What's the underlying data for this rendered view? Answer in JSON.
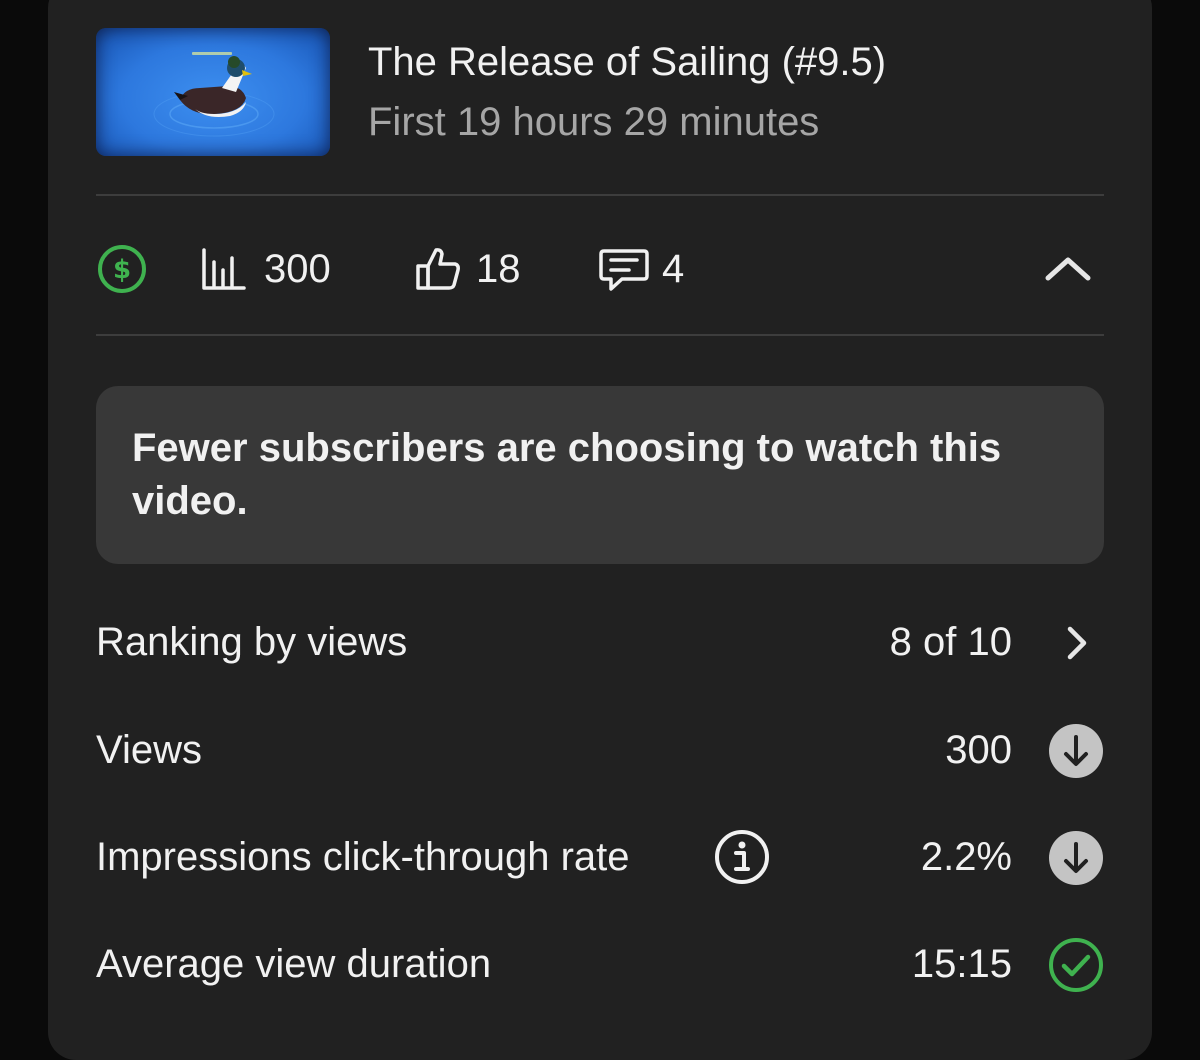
{
  "video": {
    "title": "The Release of Sailing (#9.5)",
    "period": "First 19 hours 29 minutes",
    "thumbnail_icon": "duck-thumbnail-image"
  },
  "stats": {
    "monetization_icon": "dollar-circle-icon",
    "monetization_color": "#3fb24f",
    "views": "300",
    "likes": "18",
    "comments": "4",
    "collapse_icon": "chevron-up-icon"
  },
  "insight": {
    "text": "Fewer subscribers are choosing to watch this video."
  },
  "metrics": [
    {
      "label": "Ranking by views",
      "value": "8 of 10",
      "status_icon": "chevron-right-icon"
    },
    {
      "label": "Views",
      "value": "300",
      "status_icon": "arrow-down-circle-icon"
    },
    {
      "label": "Impressions click-through rate",
      "value": "2.2%",
      "status_icon": "arrow-down-circle-icon",
      "info_icon": "info-icon"
    },
    {
      "label": "Average view duration",
      "value": "15:15",
      "status_icon": "check-circle-icon",
      "status_color": "#3fb24f"
    }
  ]
}
